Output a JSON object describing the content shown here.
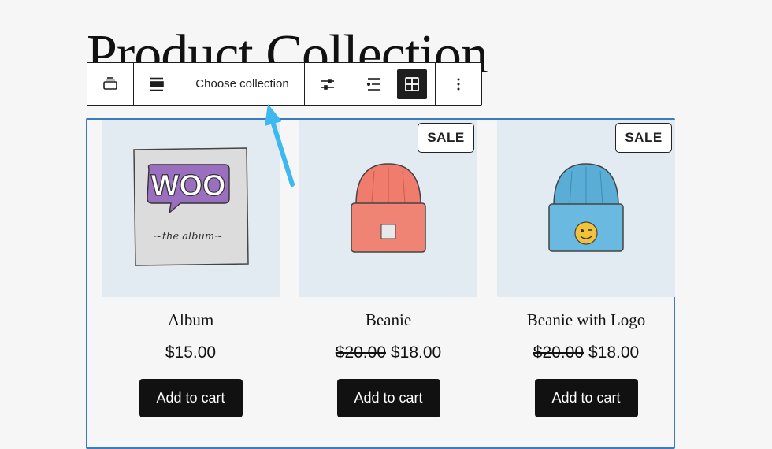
{
  "page": {
    "title": "Product Collection"
  },
  "toolbar": {
    "buttons": [
      {
        "icon": "product-collection-block-icon"
      },
      {
        "icon": "align-icon"
      },
      {
        "label": "Choose collection"
      },
      {
        "icon": "settings-sliders-icon"
      },
      {
        "icon": "list-view-icon"
      },
      {
        "icon": "grid-view-icon",
        "pressed": true
      },
      {
        "icon": "more-options-icon"
      }
    ]
  },
  "products": [
    {
      "name": "Album",
      "price": "$15.00",
      "old_price": "",
      "sale": false,
      "button": "Add to cart",
      "image": "woo-album"
    },
    {
      "name": "Beanie",
      "price": "$18.00",
      "old_price": "$20.00",
      "sale": true,
      "sale_label": "SALE",
      "button": "Add to cart",
      "image": "red-beanie"
    },
    {
      "name": "Beanie with Logo",
      "price": "$18.00",
      "old_price": "$20.00",
      "sale": true,
      "sale_label": "SALE",
      "button": "Add to cart",
      "image": "blue-beanie-logo"
    }
  ],
  "colors": {
    "block_outline": "#3d7bc0",
    "arrow": "#3fb8f0",
    "button_bg": "#111111",
    "image_bg": "#e3ebf2"
  }
}
